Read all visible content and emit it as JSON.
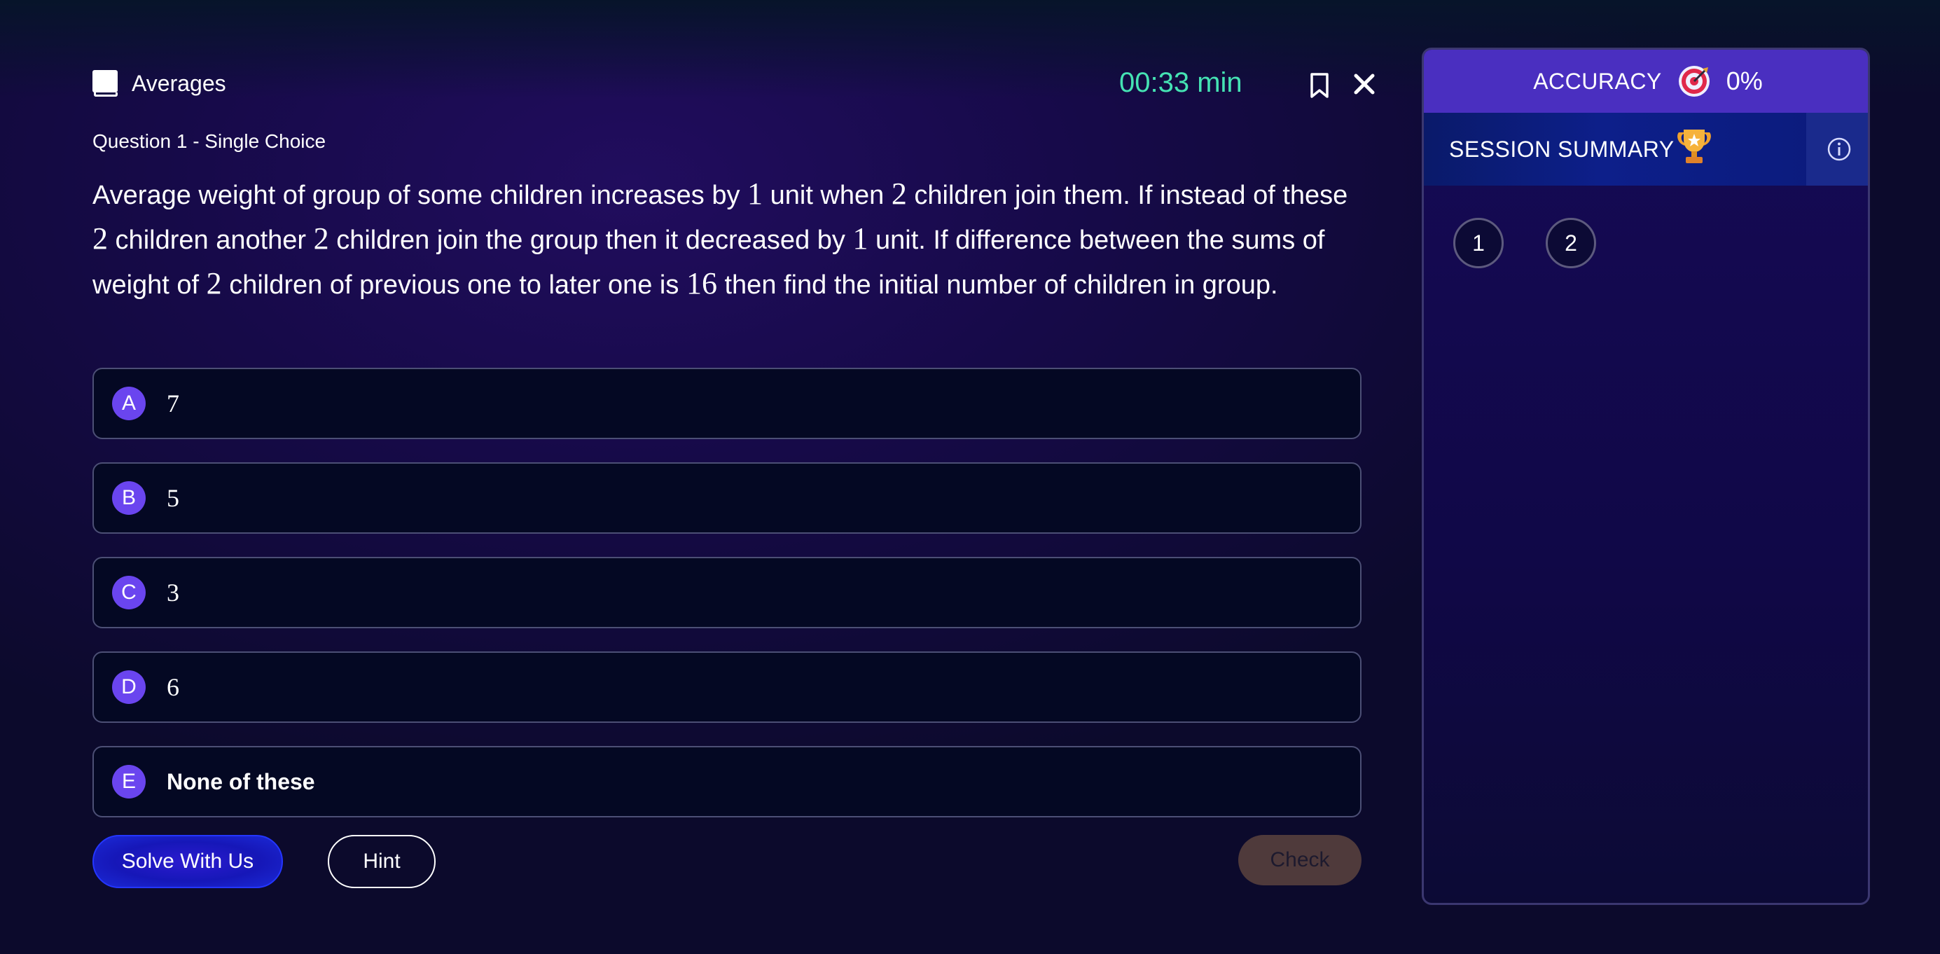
{
  "header": {
    "topic": "Averages",
    "timer": "00:33 min",
    "question_type": "Question 1 - Single Choice"
  },
  "question": {
    "parts": [
      {
        "t": "Average weight of group of some children increases by ",
        "n": false
      },
      {
        "t": "1",
        "n": true
      },
      {
        "t": " unit when ",
        "n": false
      },
      {
        "t": "2",
        "n": true
      },
      {
        "t": " children join them. If instead of these ",
        "n": false
      },
      {
        "t": "2",
        "n": true
      },
      {
        "t": " children another ",
        "n": false
      },
      {
        "t": "2",
        "n": true
      },
      {
        "t": " children join the group then it decreased by ",
        "n": false
      },
      {
        "t": "1",
        "n": true
      },
      {
        "t": " unit. If difference between the sums of weight of ",
        "n": false
      },
      {
        "t": "2",
        "n": true
      },
      {
        "t": " children of previous one to later one is ",
        "n": false
      },
      {
        "t": "16",
        "n": true
      },
      {
        "t": " then find the initial number of children in group.",
        "n": false
      }
    ]
  },
  "options": [
    {
      "letter": "A",
      "text": "7"
    },
    {
      "letter": "B",
      "text": "5"
    },
    {
      "letter": "C",
      "text": "3"
    },
    {
      "letter": "D",
      "text": "6"
    },
    {
      "letter": "E",
      "text": "None of these"
    }
  ],
  "actions": {
    "solve_label": "Solve With Us",
    "hint_label": "Hint",
    "check_label": "Check"
  },
  "panel": {
    "accuracy_label": "ACCURACY",
    "accuracy_value": "0%",
    "summary_label": "SESSION SUMMARY",
    "questions": [
      "1",
      "2"
    ]
  },
  "icons": {
    "topic": "book-icon",
    "bookmark": "bookmark-icon",
    "close": "close-icon",
    "accuracy": "target-icon",
    "summary": "trophy-icon",
    "info": "info-icon"
  },
  "colors": {
    "timer": "#45e3b3",
    "option_letter_bg": "#6a45ef",
    "accuracy_bar": "#4a2fc0",
    "check_button": "#4f3a3b"
  }
}
